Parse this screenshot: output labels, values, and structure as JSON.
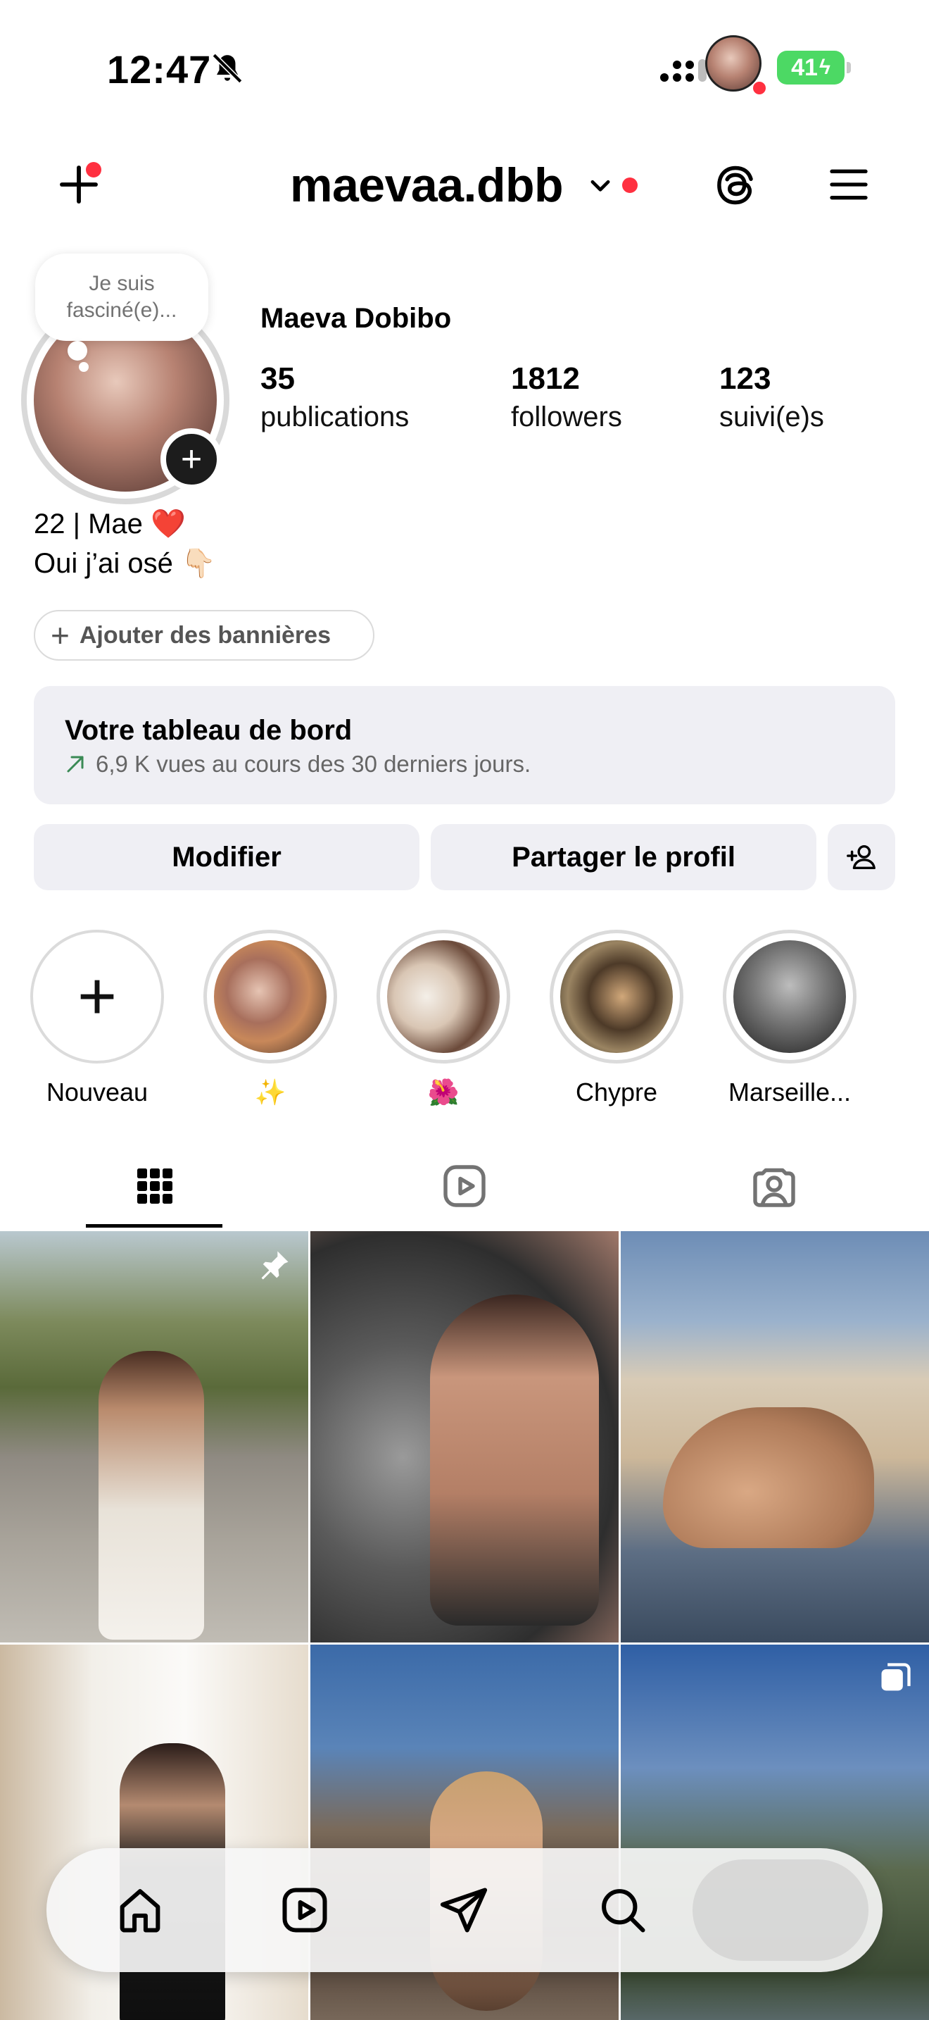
{
  "status_bar": {
    "time": "12:47",
    "battery": "41"
  },
  "header": {
    "username": "maevaa.dbb"
  },
  "profile": {
    "note": "Je suis fasciné(e)...",
    "full_name": "Maeva Dobibo",
    "stats": [
      {
        "value": "35",
        "label": "publications"
      },
      {
        "value": "1812",
        "label": "followers"
      },
      {
        "value": "123",
        "label": "suivi(e)s"
      }
    ],
    "bio_line1": "22 | Mae ❤️",
    "bio_line2": "Oui j’ai osé 👇🏻",
    "banner_button": "Ajouter des bannières"
  },
  "dashboard": {
    "title": "Votre tableau de bord",
    "subtitle": "6,9 K vues au cours des 30 derniers jours."
  },
  "actions": {
    "edit": "Modifier",
    "share": "Partager le profil"
  },
  "highlights": [
    {
      "label": "Nouveau"
    },
    {
      "label": "✨"
    },
    {
      "label": "🌺"
    },
    {
      "label": "Chypre"
    },
    {
      "label": "Marseille..."
    }
  ],
  "colors": {
    "notification": "#ff3040",
    "battery": "#4cd964",
    "button_bg": "#efeff4"
  }
}
